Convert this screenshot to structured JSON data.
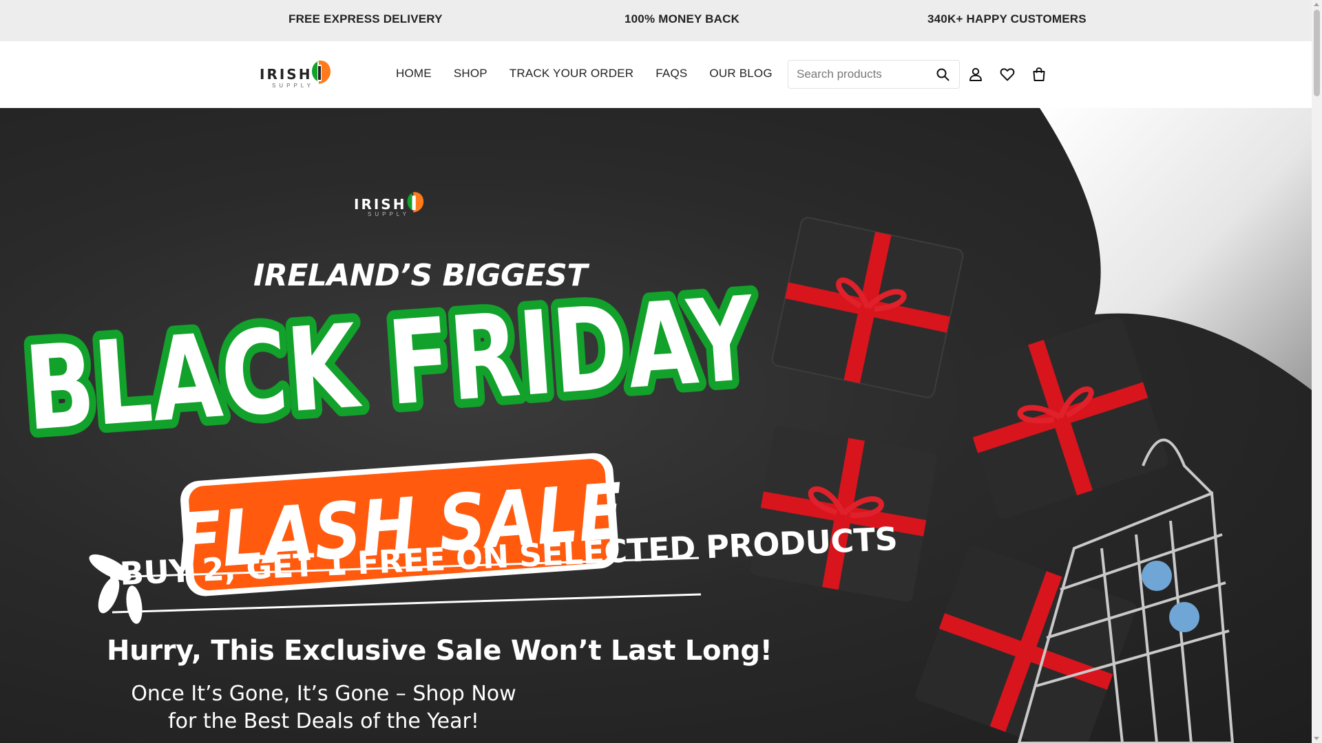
{
  "announcement": {
    "items": [
      "FREE EXPRESS DELIVERY",
      "100% MONEY BACK",
      "340K+ HAPPY CUSTOMERS"
    ]
  },
  "header": {
    "logo": {
      "word": "IRISH",
      "sub": "SUPPLY"
    },
    "nav": [
      "HOME",
      "SHOP",
      "TRACK YOUR ORDER",
      "FAQS",
      "OUR BLOG"
    ],
    "search": {
      "placeholder": "Search products"
    },
    "icons": [
      "search-icon",
      "user-icon",
      "heart-icon",
      "bag-icon"
    ]
  },
  "hero": {
    "logo": {
      "word": "IRISH",
      "sub": "SUPPLY"
    },
    "kicker": "IRELAND’S BIGGEST",
    "headline": "BLACK FRIDAY",
    "badge": "FLASH SALE",
    "promo": "BUY 2, GET 1 FREE ON SELECTED PRODUCTS",
    "hurry": "Hurry, This Exclusive Sale Won’t Last Long!",
    "subline": "Once It’s Gone, It’s Gone – Shop Now for the Best Deals of the Year!"
  },
  "colors": {
    "green": "#12a12a",
    "orange": "#ff5a0e",
    "ribbon": "#d8141d",
    "bar_bg": "#ededed"
  }
}
